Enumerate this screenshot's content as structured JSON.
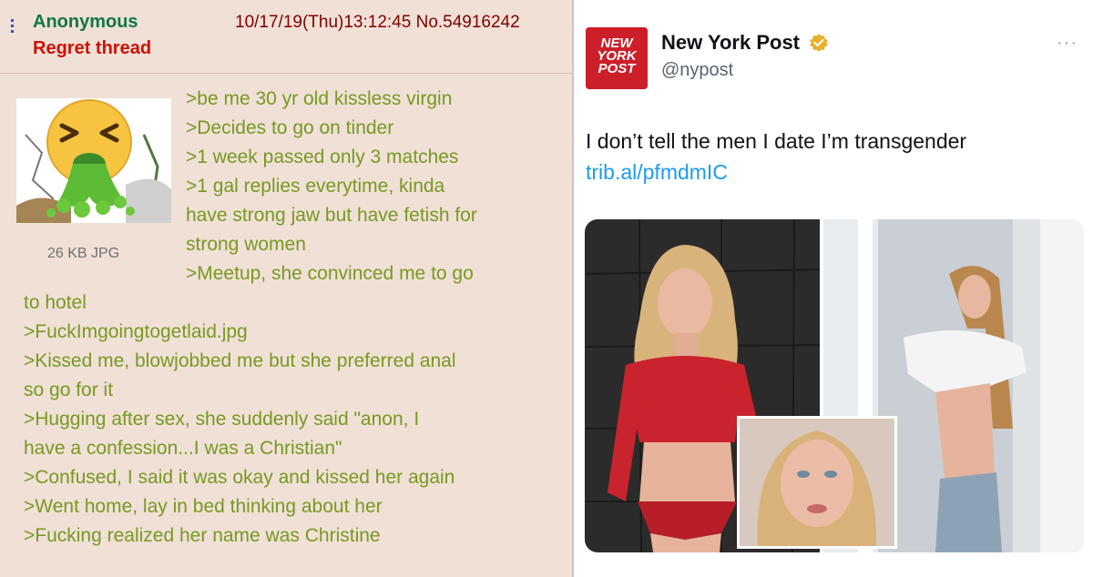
{
  "chan_post": {
    "name": "Anonymous",
    "subject": "Regret thread",
    "datetime": "10/17/19(Thu)13:12:45",
    "post_number": "No.54916242",
    "file_info": "26 KB JPG",
    "thumbnail_icon": "vomiting-face-emoji",
    "lines": [
      ">be me 30 yr old kissless virgin",
      ">Decides to go on tinder",
      ">1 week passed only 3 matches",
      ">1 gal replies everytime, kinda",
      "have strong jaw but have fetish for",
      "strong women",
      ">Meetup, she convinced me to go",
      "to hotel",
      ">FuckImgoingtogetlaid.jpg",
      ">Kissed me, blowjobbed me but she preferred anal",
      "so go for it",
      ">Hugging after sex, she suddenly said \"anon, I",
      "have a confession...I was a Christian\"",
      ">Confused, I said it was okay and kissed her again",
      ">Went home, lay in bed thinking about her",
      ">Fucking realized her name was Christine"
    ],
    "colors": {
      "background": "#f0e0d6",
      "greentext": "#789922",
      "name": "#117743",
      "subject": "#cc1105"
    }
  },
  "tweet": {
    "logo_text": [
      "NEW",
      "YORK",
      "POST"
    ],
    "display_name": "New York Post",
    "handle": "@nypost",
    "more_label": "···",
    "text": "I don’t tell the men I date I’m transgender",
    "link": "trib.al/pfmdmIC",
    "colors": {
      "link": "#1d9bf0",
      "verified": "#e8b02a",
      "logo_bg": "#cc1f2a"
    }
  }
}
